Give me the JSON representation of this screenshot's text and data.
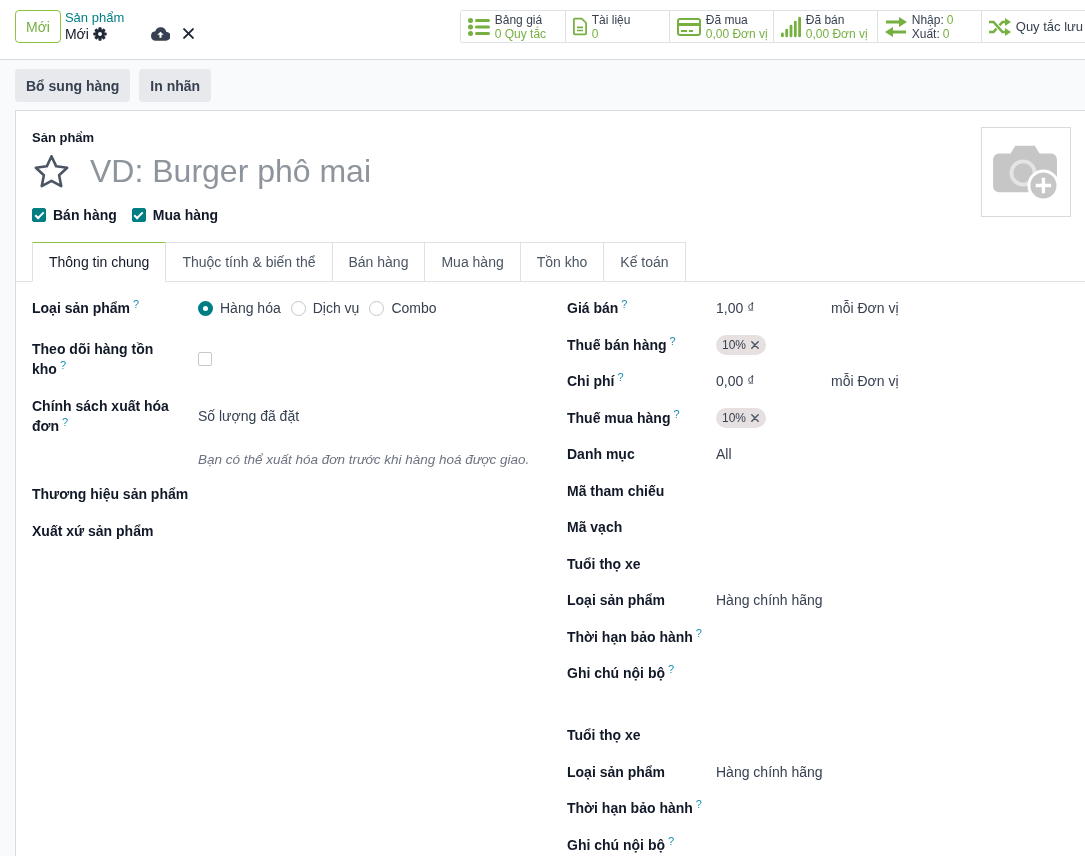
{
  "control_panel": {
    "new_button": "Mới",
    "breadcrumb": {
      "parent": "Sản phẩm",
      "current": "Mới"
    },
    "smart_buttons": [
      {
        "kind": "stat",
        "label": "Bảng giá",
        "value": "0 Quy tắc"
      },
      {
        "kind": "stat",
        "label": "Tài liệu",
        "value": "0"
      },
      {
        "kind": "stat",
        "label": "Đã mua",
        "value": "0,00 Đơn vị"
      },
      {
        "kind": "stat",
        "label": "Đã bán",
        "value": "0,00 Đơn vị"
      },
      {
        "kind": "pair",
        "rows": [
          {
            "label": "Nhập:",
            "value": "0"
          },
          {
            "label": "Xuất:",
            "value": "0"
          }
        ]
      },
      {
        "kind": "plain",
        "label": "Quy tắc lưu"
      }
    ]
  },
  "action_buttons": [
    "Bổ sung hàng",
    "In nhãn"
  ],
  "sheet": {
    "caption": "Sản phẩm",
    "favorite": false,
    "name_field": {
      "placeholder": "VD: Burger phô mai"
    },
    "options": [
      {
        "label": "Bán hàng",
        "checked": true
      },
      {
        "label": "Mua hàng",
        "checked": true
      }
    ],
    "tabs": [
      {
        "label": "Thông tin chung",
        "selected": true
      },
      {
        "label": "Thuộc tính & biến thể",
        "selected": false
      },
      {
        "label": "Bán hàng",
        "selected": false
      },
      {
        "label": "Mua hàng",
        "selected": false
      },
      {
        "label": "Tồn kho",
        "selected": false
      },
      {
        "label": "Kế toán",
        "selected": false
      }
    ],
    "left_fields": [
      {
        "kind": "radio",
        "label": "Loại sản phẩm",
        "help": "?",
        "options": [
          {
            "label": "Hàng hóa",
            "selected": true
          },
          {
            "label": "Dịch vụ",
            "selected": false
          },
          {
            "label": "Combo",
            "selected": false
          }
        ]
      },
      {
        "kind": "checkbox",
        "label": "Theo dõi hàng tồn kho",
        "help": "?",
        "checked": false
      },
      {
        "kind": "text",
        "label": "Chính sách xuất hóa đơn",
        "help": "?",
        "value": "Số lượng đã đặt"
      },
      {
        "kind": "note",
        "text": "Bạn có thể xuất hóa đơn trước khi hàng hoá được giao."
      },
      {
        "kind": "empty",
        "label": "Thương hiệu sản phẩm"
      },
      {
        "kind": "empty",
        "label": "Xuất xứ sản phẩm"
      }
    ],
    "right_groups": [
      {
        "fields": [
          {
            "kind": "price",
            "label": "Giá bán",
            "help": "?",
            "value": "1,00 ₫",
            "unit": "mỗi Đơn vị"
          },
          {
            "kind": "tags",
            "label": "Thuế bán hàng",
            "help": "?",
            "tags": [
              "10%"
            ]
          },
          {
            "kind": "price",
            "label": "Chi phí",
            "help": "?",
            "value": "0,00 ₫",
            "unit": "mỗi Đơn vị"
          },
          {
            "kind": "tags",
            "label": "Thuế mua hàng",
            "help": "?",
            "tags": [
              "10%"
            ]
          },
          {
            "kind": "text",
            "label": "Danh mục",
            "value": "All"
          },
          {
            "kind": "empty",
            "label": "Mã tham chiếu"
          },
          {
            "kind": "empty",
            "label": "Mã vạch"
          },
          {
            "kind": "empty",
            "label": "Tuổi thọ xe"
          },
          {
            "kind": "text",
            "label": "Loại sản phẩm",
            "value": "Hàng chính hãng"
          },
          {
            "kind": "empty",
            "label": "Thời hạn bảo hành",
            "help": "?"
          },
          {
            "kind": "empty",
            "label": "Ghi chú nội bộ",
            "help": "?"
          }
        ]
      },
      {
        "fields": [
          {
            "kind": "empty",
            "label": "Tuổi thọ xe"
          },
          {
            "kind": "text",
            "label": "Loại sản phẩm",
            "value": "Hàng chính hãng"
          },
          {
            "kind": "empty",
            "label": "Thời hạn bảo hành",
            "help": "?"
          },
          {
            "kind": "empty",
            "label": "Ghi chú nội bộ",
            "help": "?"
          }
        ]
      }
    ]
  }
}
